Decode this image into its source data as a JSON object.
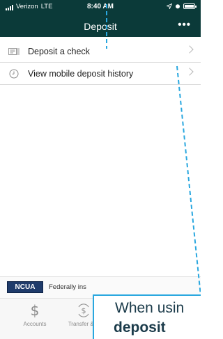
{
  "status_bar": {
    "carrier": "Verizon",
    "network": "LTE",
    "time": "8:40 AM"
  },
  "nav": {
    "title": "Deposit",
    "more_label": "•••"
  },
  "menu": {
    "items": [
      {
        "label": "Deposit a check",
        "icon": "check-scan-icon"
      },
      {
        "label": "View mobile deposit history",
        "icon": "clock-icon"
      }
    ]
  },
  "footer": {
    "ncua_label": "NCUA",
    "insured_text": "Federally ins"
  },
  "tabs": [
    {
      "label": "Accounts",
      "icon": "dollar-icon"
    },
    {
      "label": "Transfer & P",
      "icon": "transfer-dollar-icon"
    }
  ],
  "overlay": {
    "line1": "When usin",
    "line2": "deposit"
  },
  "colors": {
    "nav_background": "#0b3a39",
    "callout_border": "#29a7df",
    "ncua_blue": "#1f3b6b"
  }
}
